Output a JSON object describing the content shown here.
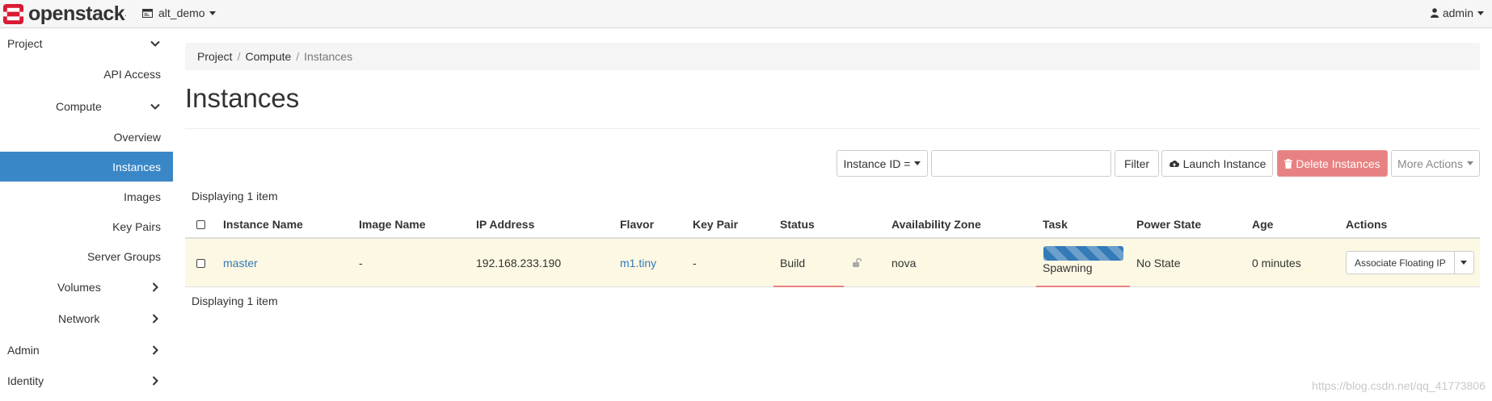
{
  "app": {
    "brand": "openstack",
    "brand_mark": ".",
    "colors": {
      "brand_red": "#da1a32",
      "active_nav": "#3a87c8",
      "link": "#337ab7",
      "danger": "#e77c7c",
      "row_highlight": "#fcf8e3"
    }
  },
  "topbar": {
    "project": "alt_demo",
    "user": "admin",
    "icons": {
      "project": "project-box-icon",
      "user": "user-icon"
    }
  },
  "sidebar": {
    "items": [
      {
        "label": "Project",
        "chevron": "down"
      },
      {
        "label": "API Access"
      },
      {
        "label": "Compute",
        "chevron": "down"
      },
      {
        "label": "Overview"
      },
      {
        "label": "Instances",
        "active": true
      },
      {
        "label": "Images"
      },
      {
        "label": "Key Pairs"
      },
      {
        "label": "Server Groups"
      },
      {
        "label": "Volumes",
        "chevron": "right"
      },
      {
        "label": "Network",
        "chevron": "right"
      },
      {
        "label": "Admin",
        "chevron": "right"
      },
      {
        "label": "Identity",
        "chevron": "right"
      }
    ]
  },
  "breadcrumb": [
    "Project",
    "Compute",
    "Instances"
  ],
  "page_title": "Instances",
  "toolbar": {
    "filter_field": "Instance ID =",
    "search_value": "",
    "filter_button": "Filter",
    "launch_button": "Launch Instance",
    "delete_button": "Delete Instances",
    "more_actions": "More Actions"
  },
  "table": {
    "count_top": "Displaying 1 item",
    "count_bottom": "Displaying 1 item",
    "columns": [
      "Instance Name",
      "Image Name",
      "IP Address",
      "Flavor",
      "Key Pair",
      "Status",
      "Availability Zone",
      "Task",
      "Power State",
      "Age",
      "Actions"
    ],
    "rows": [
      {
        "instance_name": "master",
        "image_name": "-",
        "ip_address": "192.168.233.190",
        "flavor": "m1.tiny",
        "key_pair": "-",
        "status": "Build",
        "availability_zone": "nova",
        "task": "Spawning",
        "power_state": "No State",
        "age": "0 minutes",
        "action": "Associate Floating IP"
      }
    ]
  },
  "watermark": "https://blog.csdn.net/qq_41773806"
}
